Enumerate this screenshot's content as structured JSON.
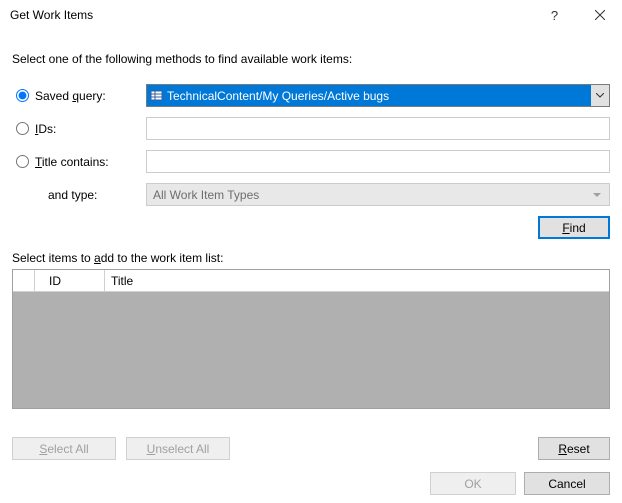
{
  "titlebar": {
    "title": "Get Work Items"
  },
  "instruction": "Select one of the following methods to find available work items:",
  "methods": {
    "savedQuery": {
      "label_pre": "Saved ",
      "label_u": "q",
      "label_post": "uery:",
      "value": "TechnicalContent/My Queries/Active bugs"
    },
    "ids": {
      "label_u": "I",
      "label_post": "Ds:",
      "value": ""
    },
    "titleContains": {
      "label_u": "T",
      "label_post": "itle contains:",
      "value": ""
    },
    "andType": {
      "label": "and type:",
      "value": "All Work Item Types"
    }
  },
  "findButton": {
    "label_u": "F",
    "label_post": "ind"
  },
  "listLabel": {
    "pre": "Select items to ",
    "u": "a",
    "post": "dd to the work item list:"
  },
  "columns": {
    "id": "ID",
    "title": "Title"
  },
  "buttons": {
    "selectAll": {
      "u": "S",
      "post": "elect All"
    },
    "unselectAll": {
      "u": "U",
      "post": "nselect All"
    },
    "reset": {
      "u": "R",
      "post": "eset"
    },
    "ok": "OK",
    "cancel": "Cancel"
  }
}
